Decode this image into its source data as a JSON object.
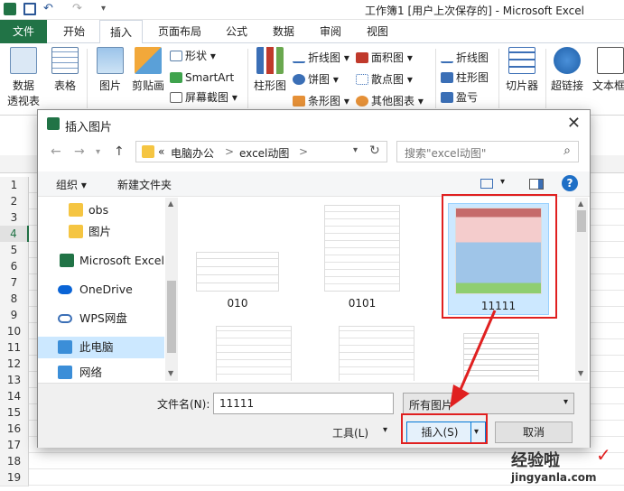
{
  "window": {
    "title": "工作簿1 [用户上次保存的] - Microsoft Excel"
  },
  "ribbon_tabs": [
    "文件",
    "开始",
    "插入",
    "页面布局",
    "公式",
    "数据",
    "审阅",
    "视图"
  ],
  "ribbon": {
    "pivot": [
      "数据",
      "透视表"
    ],
    "table": "表格",
    "picture": "图片",
    "clipart": "剪贴画",
    "shapes": "形状",
    "smartart": "SmartArt",
    "screenshot": "屏幕截图",
    "column_chart": "柱形图",
    "line_chart": "折线图",
    "pie_chart": "饼图",
    "bar_chart": "条形图",
    "area_chart": "面积图",
    "scatter_chart": "散点图",
    "other_chart": "其他图表",
    "spark_line": "折线图",
    "spark_column": "柱形图",
    "spark_winloss": "盈亏",
    "slicer": "切片器",
    "hyperlink": "超链接",
    "textbox": "文本框",
    "group_label_partial": "表"
  },
  "sheet": {
    "row_numbers": [
      "1",
      "2",
      "3",
      "4",
      "5",
      "6",
      "7",
      "8",
      "9",
      "10",
      "11",
      "12",
      "13",
      "14",
      "15",
      "16",
      "17",
      "18",
      "19"
    ],
    "selected_row": "4"
  },
  "dialog": {
    "title": "插入图片",
    "breadcrumb": [
      "«",
      "电脑办公",
      ">",
      "excel动图",
      ">"
    ],
    "search_placeholder": "搜索\"excel动图\"",
    "organize": "组织",
    "new_folder": "新建文件夹",
    "nav_items": [
      "obs",
      "图片",
      "Microsoft Excel",
      "OneDrive",
      "WPS网盘",
      "此电脑",
      "网络"
    ],
    "selected_nav": "此电脑",
    "files": [
      "010",
      "0101",
      "11111"
    ],
    "selected_file": "11111",
    "filename_label": "文件名(N):",
    "filename_value": "11111",
    "filetype_value": "所有图片",
    "tools_label": "工具(L)",
    "insert_label": "插入(S)",
    "cancel_label": "取消"
  },
  "watermark": {
    "brand": "经验啦",
    "url": "jingyanla.com"
  },
  "colors": {
    "file_tab": "#217346",
    "selection": "#cce8ff",
    "highlight_box": "#e02020"
  }
}
